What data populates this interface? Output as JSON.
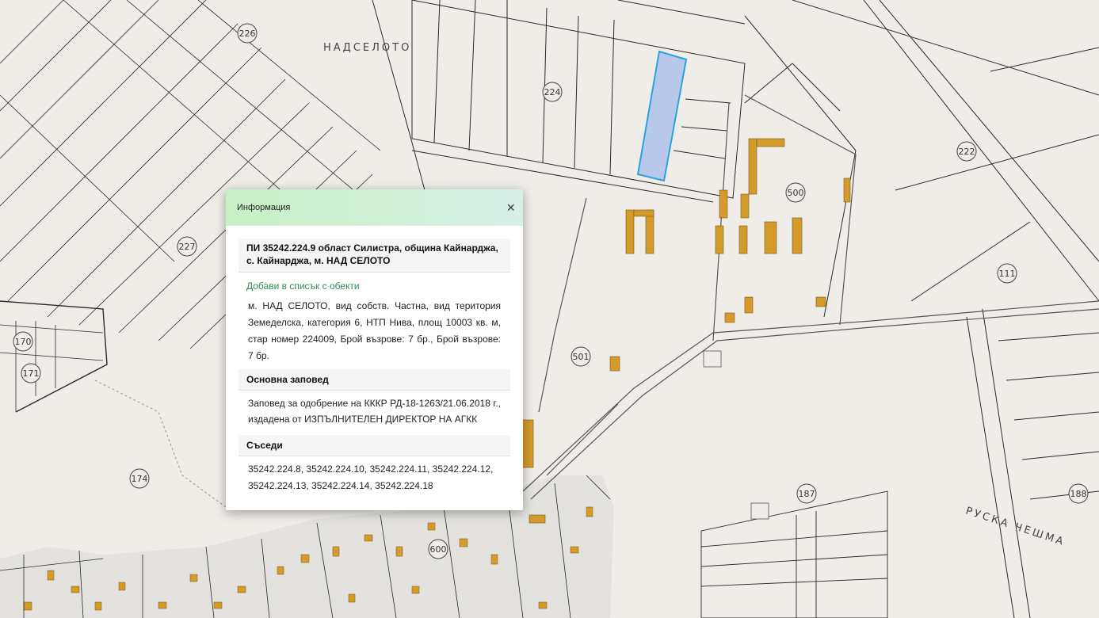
{
  "map": {
    "locality_label": "НАДСЕЛОТО",
    "area_label": "РУСКА ЧЕШМА",
    "parcel_numbers": [
      "226",
      "224",
      "227",
      "170",
      "171",
      "174",
      "500",
      "501",
      "222",
      "111",
      "187",
      "188",
      "600"
    ]
  },
  "popup": {
    "title": "Информация",
    "close_symbol": "×",
    "parcel_title": "ПИ 35242.224.9 област Силистра, община Кайнарджа, с. Кайнарджа, м. НАД СЕЛОТО",
    "add_link": "Добави в списък с обекти",
    "details": "м. НАД СЕЛОТО, вид собств. Частна, вид територия Земеделска, категория 6, НТП Нива, площ 10003 кв. м, стар номер 224009, Брой възрове: 7 бр., Брой възрове: 7 бр.",
    "order_heading": "Основна заповед",
    "order_text": "Заповед за одобрение на КККР РД-18-1263/21.06.2018 г., издадена от ИЗПЪЛНИТЕЛЕН ДИРЕКТОР НА АГКК",
    "neighbors_heading": "Съседи",
    "neighbors_text": "35242.224.8, 35242.224.10, 35242.224.11, 35242.224.12, 35242.224.13, 35242.224.14, 35242.224.18"
  },
  "colors": {
    "map_bg": "#f0ede8",
    "building": "#d49a2a",
    "selected_parcel_fill": "#b8c8ea",
    "selected_parcel_stroke": "#29a3e0",
    "link": "#2e8b57"
  }
}
